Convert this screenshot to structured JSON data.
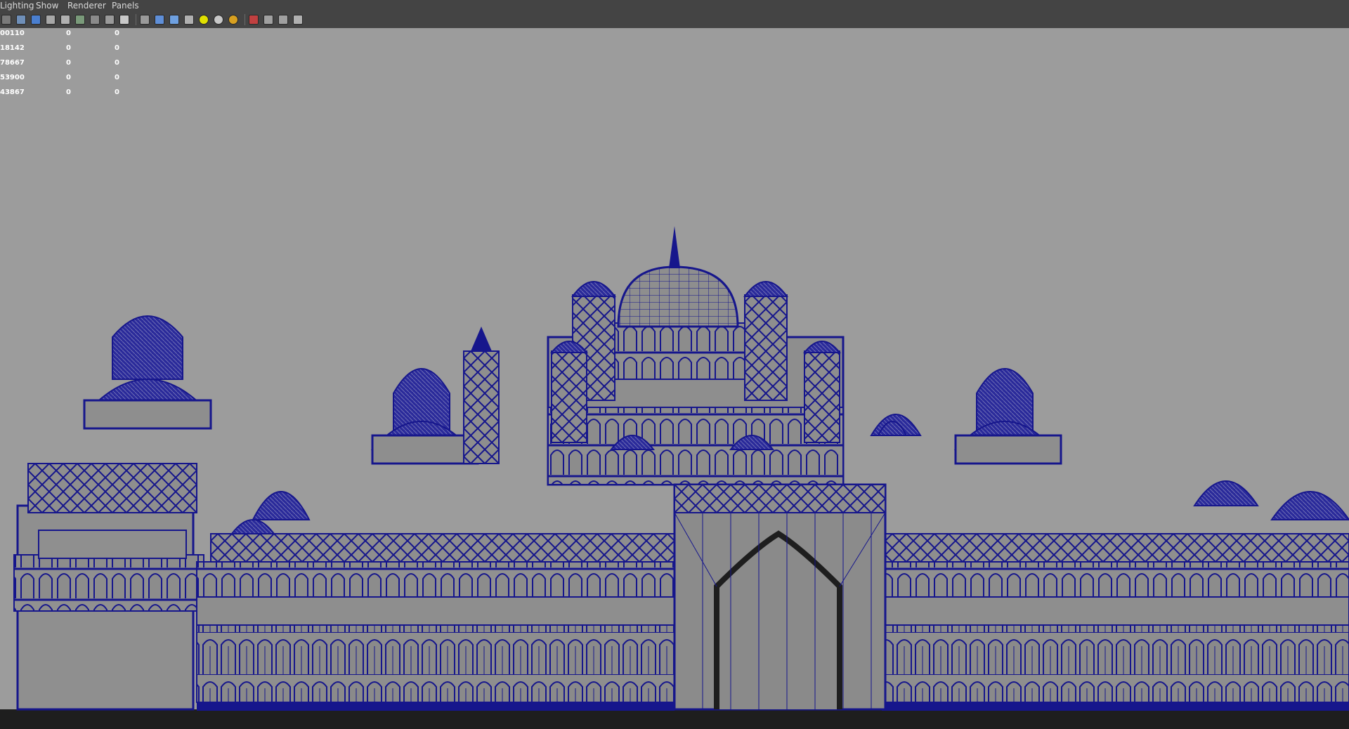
{
  "menu": {
    "items": [
      {
        "label": "Lighting"
      },
      {
        "label": "Show"
      },
      {
        "label": "Renderer"
      },
      {
        "label": "Panels"
      }
    ]
  },
  "toolbar": {
    "icons": [
      "camera-attributes-icon",
      "bookmarks-icon",
      "image-plane-icon",
      "grid-icon",
      "film-gate-icon",
      "resolution-gate-icon",
      "gate-mask-icon",
      "field-chart-icon",
      "safe-action-icon",
      "wireframe-icon",
      "smooth-shade-icon",
      "wireframe-on-shaded-icon",
      "textured-icon",
      "use-default-light-icon",
      "shadows-icon",
      "ambient-occlusion-icon",
      "isolate-select-icon",
      "xray-icon",
      "xray-joints-icon",
      "xray-components-icon"
    ]
  },
  "heads_up_display": {
    "rows": [
      {
        "label": "00110",
        "a": "0",
        "b": "0"
      },
      {
        "label": "18142",
        "a": "0",
        "b": "0"
      },
      {
        "label": "78667",
        "a": "0",
        "b": "0"
      },
      {
        "label": "53900",
        "a": "0",
        "b": "0"
      },
      {
        "label": "43867",
        "a": "0",
        "b": "0"
      }
    ]
  },
  "colors": {
    "viewport_bg": "#9c9c9c",
    "menubar_bg": "#444444",
    "wire": "#16168c",
    "shaded": "#8e8e8e",
    "floor": "#1e1e1e"
  }
}
